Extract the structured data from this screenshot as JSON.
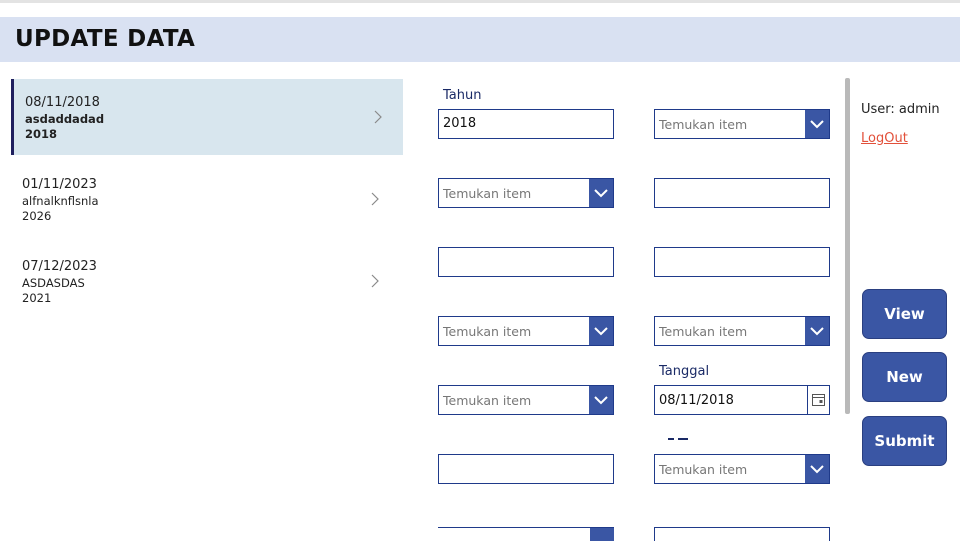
{
  "header": {
    "title": "UPDATE DATA"
  },
  "gallery": {
    "items": [
      {
        "date": "08/11/2018",
        "name": "asdaddadad",
        "year": "2018",
        "selected": true
      },
      {
        "date": "01/11/2023",
        "name": "alfnalknflsnla",
        "year": "2026",
        "selected": false
      },
      {
        "date": "07/12/2023",
        "name": "ASDASDAS",
        "year": "2021",
        "selected": false
      }
    ]
  },
  "form": {
    "tahun_label": "Tahun",
    "tahun_value": "2018",
    "tanggal_label": "Tanggal",
    "tanggal_value": "08/11/2018",
    "dropdown_placeholder": "Temukan item"
  },
  "sidebar": {
    "user_text": "User: admin",
    "logout_label": "LogOut",
    "view_label": "View",
    "new_label": "New",
    "submit_label": "Submit"
  },
  "colors": {
    "header_bg": "#d9e1f2",
    "selected_bg": "#d8e6ee",
    "accent": "#3a56a4",
    "logout": "#e2503a"
  }
}
